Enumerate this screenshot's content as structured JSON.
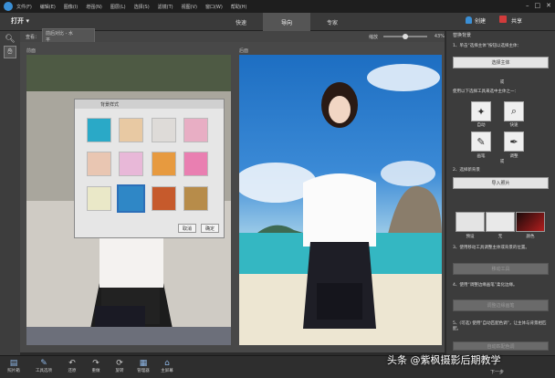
{
  "menu": {
    "items": [
      "文件(F)",
      "编辑(E)",
      "图像(I)",
      "增强(N)",
      "图层(L)",
      "选择(S)",
      "滤镜(T)",
      "视图(V)",
      "窗口(W)",
      "帮助(H)"
    ]
  },
  "toolbar": {
    "open": "打开",
    "open_arrow": "▾",
    "modes": [
      "快速",
      "导向",
      "专家"
    ],
    "create": "创建",
    "share": "共享"
  },
  "options": {
    "view_label": "查看：",
    "view_value": "前后对比 - 水平",
    "zoom_label": "缩放",
    "zoom_value": "43%",
    "zoom_level": 0.43
  },
  "panels": {
    "before": "前面",
    "after": "后面"
  },
  "dialog": {
    "title": "背景样式",
    "cancel": "取消",
    "confirm": "确定",
    "swatches": [
      "#2aa9c7",
      "#e8c9a3",
      "#dedbd8",
      "#e8aec4",
      "#e9c6b2",
      "#e8b8d8",
      "#e79a3f",
      "#e97fb1",
      "#eae8c8",
      "#2f87c6",
      "#c65a2c",
      "#b78c4a"
    ]
  },
  "right": {
    "title": "替换背景",
    "step1": "1、单击“选择主体”按钮以选择主体：",
    "select_subject": "选择主体",
    "or": "或",
    "step1b": "使用以下选择工具来选中主体之一：",
    "tools": [
      "自动",
      "快速",
      "画笔",
      "调整"
    ],
    "or2": "或",
    "step2": "2、选择新背景",
    "import_photo": "导入照片",
    "presets": [
      "预设",
      "无",
      "颜色"
    ],
    "step3": "3、使用移动工具调整主体或背景的位置。",
    "move_tool": "移动工具",
    "step4": "4、使用“调整边缘画笔”柔化边缘。",
    "refine_brush": "调整边缘画笔",
    "step5": "5、(可选) 使用“自动匹配色调”，让主体与背景相匹配。",
    "auto_match": "自动匹配色调"
  },
  "bottom": [
    "照片箱",
    "工具选项",
    "还原",
    "重做",
    "旋转",
    "管理器",
    "主屏幕"
  ],
  "bottom_right": "下一步",
  "watermark": "头条 @紫枫摄影后期教学"
}
